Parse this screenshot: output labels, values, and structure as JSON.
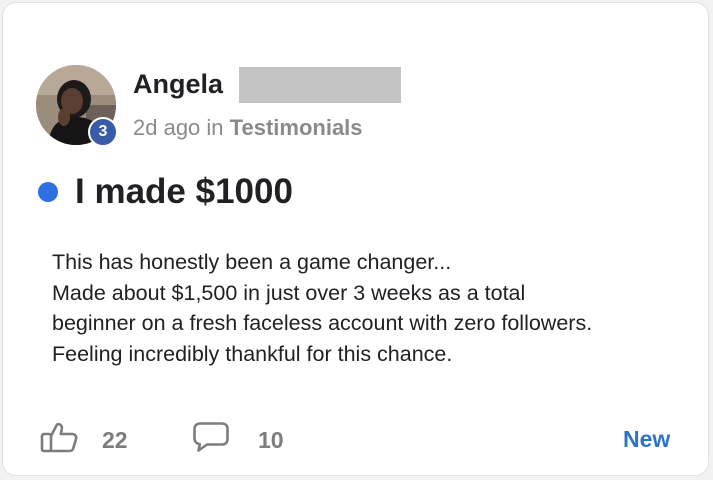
{
  "post": {
    "author": {
      "name": "Angela",
      "level": "3"
    },
    "meta": {
      "time": "2d ago",
      "in_word": "in",
      "category": "Testimonials"
    },
    "title": "I made $1000",
    "body_lines": [
      "This has honestly been a game changer...",
      "Made about $1,500 in just over 3 weeks as a total",
      "beginner on a fresh faceless account with zero followers.",
      "Feeling incredibly thankful for this chance."
    ],
    "likes": "22",
    "comments": "10",
    "new_label": "New"
  },
  "colors": {
    "unread_dot": "#2f6fe4",
    "level_badge": "#3a5ba8",
    "new_label": "#2f73c9",
    "muted_text": "#8a8a8a"
  },
  "icons": {
    "like": "thumbs-up-icon",
    "comment": "comment-bubble-icon"
  }
}
